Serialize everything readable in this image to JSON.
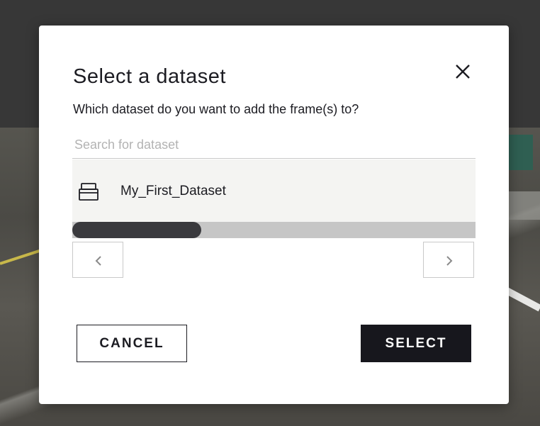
{
  "dialog": {
    "title": "Select a dataset",
    "subtitle": "Which dataset do you want to add the frame(s) to?",
    "close_icon": "close-icon"
  },
  "search": {
    "value": "",
    "placeholder": "Search for dataset"
  },
  "datasets": [
    {
      "label": "My_First_Dataset",
      "icon": "database-icon"
    }
  ],
  "scrollbar": {
    "thumb_fraction": 0.32
  },
  "pagination": {
    "prev_icon": "chevron-left-icon",
    "next_icon": "chevron-right-icon"
  },
  "actions": {
    "cancel_label": "CANCEL",
    "select_label": "SELECT"
  },
  "colors": {
    "primary": "#17171d",
    "list_background": "#f4f4f2",
    "scroll_track": "#c6c6c6",
    "scroll_thumb": "#3a3a3e"
  }
}
